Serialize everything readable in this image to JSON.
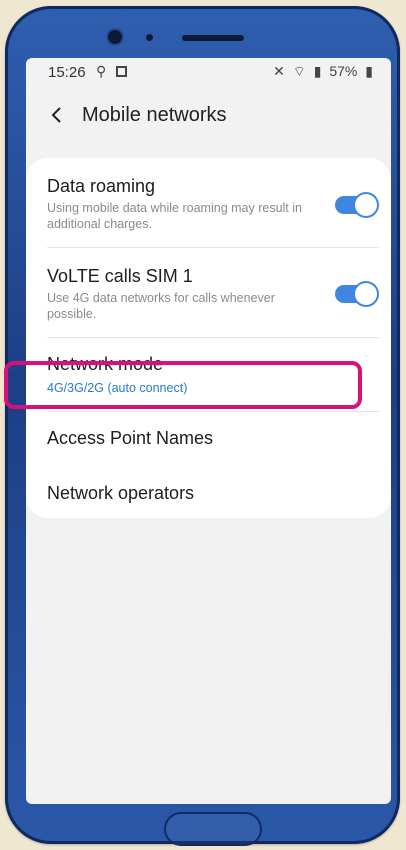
{
  "statusbar": {
    "time": "15:26",
    "icons_left": [
      "location-icon",
      "photo-icon"
    ],
    "battery": "57%",
    "icons_right": [
      "mute-icon",
      "wifi-icon",
      "signal-icon",
      "battery-icon"
    ]
  },
  "header": {
    "back_icon": "back-chevron-icon",
    "title": "Mobile networks"
  },
  "settings": {
    "data_roaming": {
      "title": "Data roaming",
      "subtitle": "Using mobile data while roaming may result in additional charges.",
      "enabled": true
    },
    "volte": {
      "title": "VoLTE calls SIM 1",
      "subtitle": "Use 4G data networks for calls whenever possible.",
      "enabled": true
    },
    "network_mode": {
      "title": "Network mode",
      "value": "4G/3G/2G (auto connect)"
    },
    "apn": {
      "title": "Access Point Names"
    },
    "operators": {
      "title": "Network operators"
    }
  },
  "colors": {
    "accent": "#3e86e0",
    "highlight": "#d6127a",
    "phone_body": "#1c3f86"
  }
}
